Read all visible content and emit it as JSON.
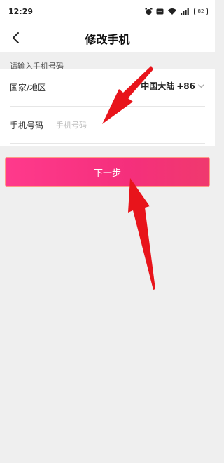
{
  "status_bar": {
    "time": "12:29",
    "battery": "82",
    "icons": [
      "alarm-icon",
      "hd-icon",
      "wifi-icon",
      "signal-icon",
      "battery-icon"
    ]
  },
  "nav": {
    "title": "修改手机",
    "back_icon": "chevron-left-icon"
  },
  "form": {
    "hint": "请输入手机号码",
    "country_label": "国家/地区",
    "country_name": "中国大陆",
    "country_code": "+86",
    "phone_label": "手机号码",
    "phone_placeholder": "手机号码",
    "phone_value": ""
  },
  "actions": {
    "next_label": "下一步"
  },
  "colors": {
    "accent": "#f52f7c",
    "annotation_arrow": "#e8141b",
    "background": "#efefef"
  }
}
